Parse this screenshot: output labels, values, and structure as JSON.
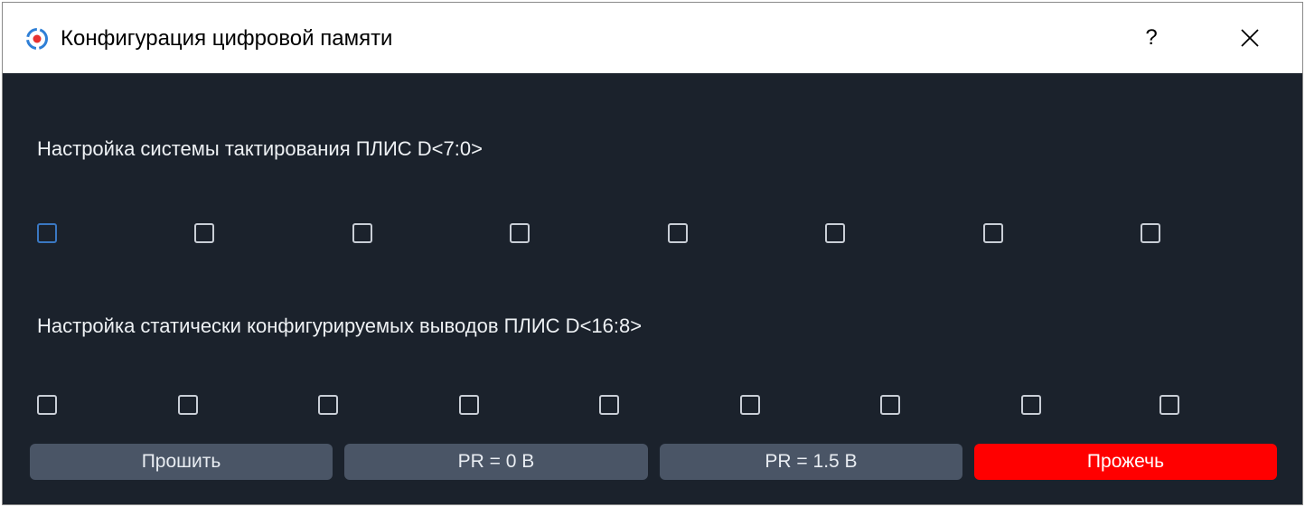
{
  "window": {
    "title": "Конфигурация цифровой памяти",
    "help_label": "?",
    "app_icon": "app-logo-icon",
    "close_icon": "close-icon"
  },
  "sections": [
    {
      "label": "Настройка системы тактирования ПЛИС D<7:0>",
      "checkboxes": [
        {
          "checked": false,
          "focused": true
        },
        {
          "checked": false
        },
        {
          "checked": false
        },
        {
          "checked": false
        },
        {
          "checked": false
        },
        {
          "checked": false
        },
        {
          "checked": false
        },
        {
          "checked": false
        }
      ]
    },
    {
      "label": "Настройка статически конфигурируемых выводов ПЛИС D<16:8>",
      "checkboxes": [
        {
          "checked": false
        },
        {
          "checked": false
        },
        {
          "checked": false
        },
        {
          "checked": false
        },
        {
          "checked": false
        },
        {
          "checked": false
        },
        {
          "checked": false
        },
        {
          "checked": false
        },
        {
          "checked": false
        }
      ]
    }
  ],
  "buttons": {
    "flash": "Прошить",
    "pr0": "PR = 0 B",
    "pr15": "PR = 1.5 B",
    "burn": "Прожечь"
  },
  "colors": {
    "background": "#1b222c",
    "button": "#4a5566",
    "burn_button": "#ff0000",
    "focus": "#3a78c2"
  }
}
